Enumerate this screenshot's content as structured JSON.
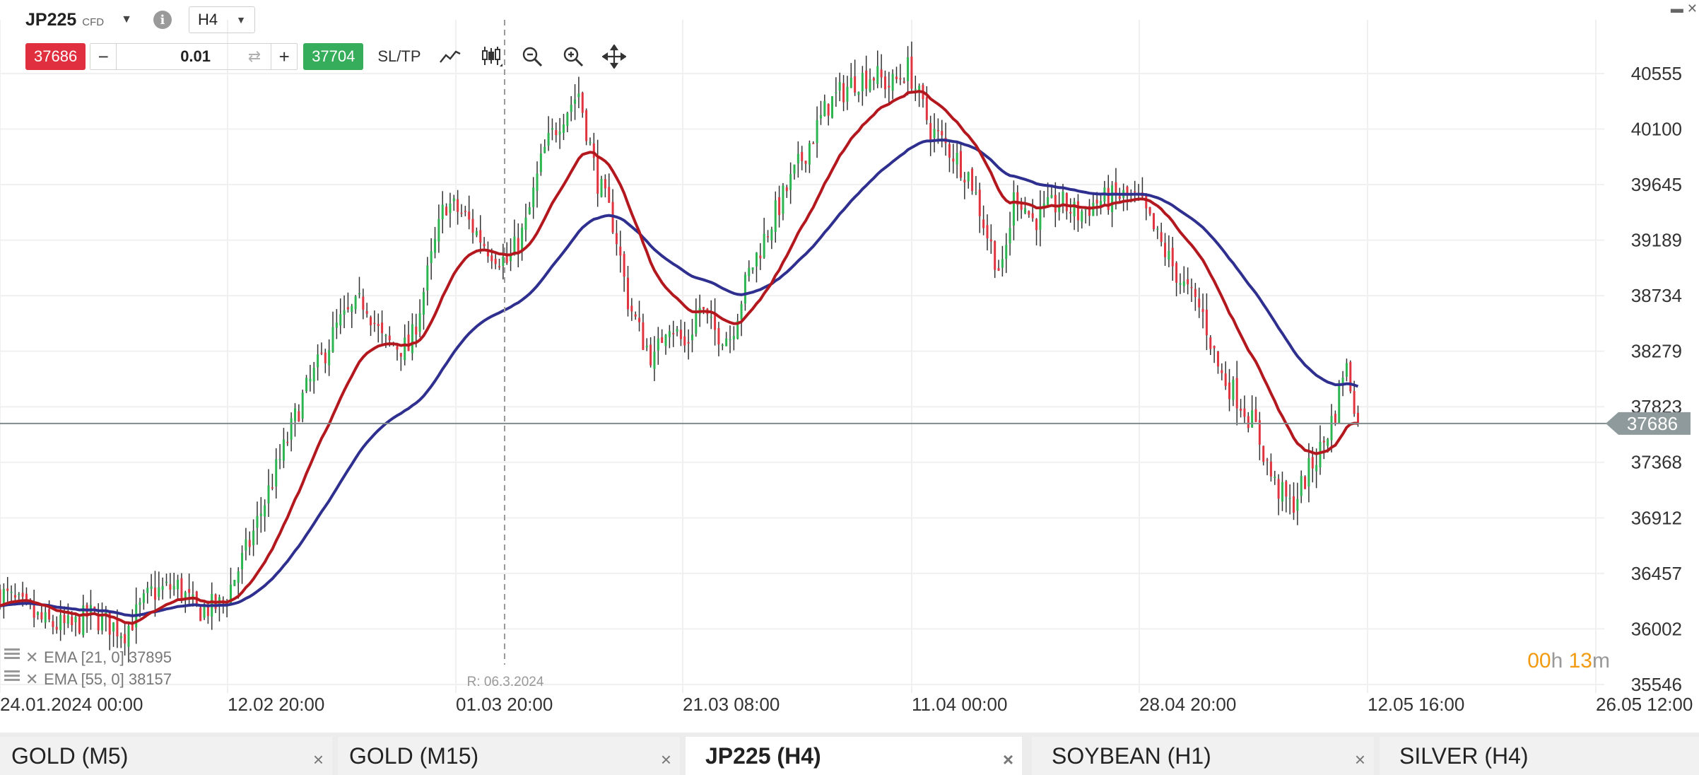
{
  "header": {
    "symbol": "JP225",
    "symbol_type": "CFD",
    "info": "i",
    "timeframe": "H4"
  },
  "trade_bar": {
    "sell_price": "37686",
    "buy_price": "37704",
    "quantity": "0.01",
    "minus": "−",
    "plus": "+",
    "sltp_label": "SL/TP"
  },
  "icons": [
    "line-chart-icon",
    "candlestick-icon",
    "zoom-out-icon",
    "zoom-in-icon",
    "move-icon"
  ],
  "tabs": [
    {
      "label": "GOLD (M5)",
      "active": false
    },
    {
      "label": "GOLD (M15)",
      "active": false
    },
    {
      "label": "JP225 (H4)",
      "active": true
    },
    {
      "label": "SOYBEAN (H1)",
      "active": false
    },
    {
      "label": "SILVER (H4)",
      "active": false
    }
  ],
  "colors": {
    "up": "#2db552",
    "down": "#e03440",
    "ema21": "#b3181f",
    "ema55": "#2e2f8e",
    "countdown": "#f29b11",
    "current_line": "#7f8c8d"
  },
  "chart_data": {
    "type": "candlestick",
    "instrument": "JP225",
    "timeframe": "H4",
    "y_ticks": [
      40555,
      40100,
      39645,
      39189,
      38734,
      38279,
      37823,
      37368,
      36912,
      36457,
      36002,
      35546
    ],
    "ylim": [
      35450,
      41050
    ],
    "x_ticks": [
      "24.01.2024 00:00",
      "12.02 20:00",
      "01.03 20:00",
      "21.03 08:00",
      "11.04 00:00",
      "28.04 20:00",
      "12.05 16:00",
      "26.05 12:00"
    ],
    "current_price": "37686",
    "crosshair_label": "R: 06.3.2024",
    "countdown": {
      "h": "00",
      "h_unit": "h",
      "m": "13",
      "m_unit": "m"
    },
    "legend": [
      {
        "name": "EMA [21, 0]",
        "value": "37895",
        "label": "EMA [21, 0] 37895"
      },
      {
        "name": "EMA [55, 0]",
        "value": "38157",
        "label": "EMA [55, 0] 38157"
      }
    ],
    "close_series": [
      {
        "t": 0,
        "close": 36300
      },
      {
        "t": 0.05,
        "close": 36050
      },
      {
        "t": 0.08,
        "close": 36010
      },
      {
        "t": 0.1,
        "close": 36120
      },
      {
        "t": 0.14,
        "close": 35980
      },
      {
        "t": 0.17,
        "close": 36300
      },
      {
        "t": 0.2,
        "close": 36350
      },
      {
        "t": 0.22,
        "close": 36150
      },
      {
        "t": 0.25,
        "close": 36200
      },
      {
        "t": 0.28,
        "close": 36700
      },
      {
        "t": 0.31,
        "close": 37300
      },
      {
        "t": 0.34,
        "close": 37900
      },
      {
        "t": 0.38,
        "close": 38500
      },
      {
        "t": 0.41,
        "close": 38700
      },
      {
        "t": 0.43,
        "close": 38350
      },
      {
        "t": 0.46,
        "close": 38300
      },
      {
        "t": 0.48,
        "close": 38900
      },
      {
        "t": 0.5,
        "close": 39500
      },
      {
        "t": 0.52,
        "close": 39400
      },
      {
        "t": 0.545,
        "close": 39150
      },
      {
        "t": 0.57,
        "close": 39000
      },
      {
        "t": 0.59,
        "close": 39300
      },
      {
        "t": 0.61,
        "close": 39900
      },
      {
        "t": 0.63,
        "close": 40200
      },
      {
        "t": 0.65,
        "close": 40400
      },
      {
        "t": 0.67,
        "close": 39700
      },
      {
        "t": 0.69,
        "close": 39300
      },
      {
        "t": 0.705,
        "close": 38700
      },
      {
        "t": 0.72,
        "close": 38400
      },
      {
        "t": 0.735,
        "close": 38200
      },
      {
        "t": 0.75,
        "close": 38550
      },
      {
        "t": 0.77,
        "close": 38300
      },
      {
        "t": 0.785,
        "close": 38650
      },
      {
        "t": 0.8,
        "close": 38450
      },
      {
        "t": 0.82,
        "close": 38400
      },
      {
        "t": 0.84,
        "close": 38900
      },
      {
        "t": 0.87,
        "close": 39400
      },
      {
        "t": 0.9,
        "close": 39850
      },
      {
        "t": 0.93,
        "close": 40300
      },
      {
        "t": 0.96,
        "close": 40500
      },
      {
        "t": 0.98,
        "close": 40550
      },
      {
        "t": 1.0,
        "close": 40450
      },
      {
        "t": 1.02,
        "close": 40600
      },
      {
        "t": 1.045,
        "close": 40100
      },
      {
        "t": 1.07,
        "close": 39900
      },
      {
        "t": 1.09,
        "close": 39700
      },
      {
        "t": 1.11,
        "close": 39200
      },
      {
        "t": 1.125,
        "close": 38900
      },
      {
        "t": 1.14,
        "close": 39600
      },
      {
        "t": 1.16,
        "close": 39350
      },
      {
        "t": 1.19,
        "close": 39500
      },
      {
        "t": 1.21,
        "close": 39400
      },
      {
        "t": 1.23,
        "close": 39500
      },
      {
        "t": 1.26,
        "close": 39550
      },
      {
        "t": 1.28,
        "close": 39500
      },
      {
        "t": 1.3,
        "close": 39200
      },
      {
        "t": 1.33,
        "close": 38800
      },
      {
        "t": 1.35,
        "close": 38600
      },
      {
        "t": 1.37,
        "close": 38100
      },
      {
        "t": 1.39,
        "close": 37900
      },
      {
        "t": 1.41,
        "close": 37650
      },
      {
        "t": 1.43,
        "close": 37200
      },
      {
        "t": 1.45,
        "close": 37000
      },
      {
        "t": 1.47,
        "close": 37300
      },
      {
        "t": 1.485,
        "close": 37500
      },
      {
        "t": 1.5,
        "close": 37800
      },
      {
        "t": 1.51,
        "close": 38200
      },
      {
        "t": 1.52,
        "close": 37900
      },
      {
        "t": 1.525,
        "close": 37686
      }
    ]
  }
}
